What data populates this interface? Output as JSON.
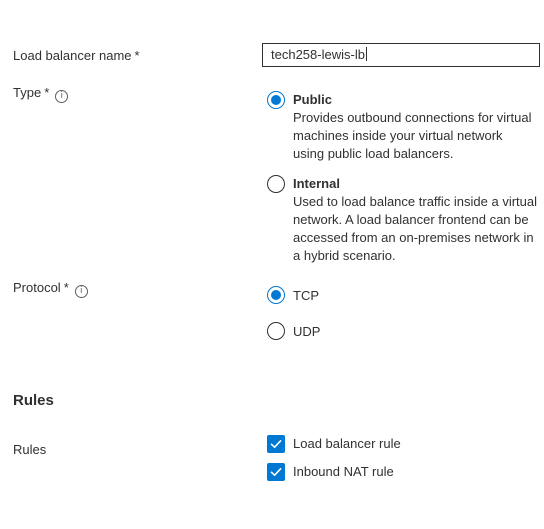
{
  "form": {
    "lb_name": {
      "label": "Load balancer name",
      "required_mark": "*",
      "value": "tech258-lewis-lb"
    },
    "type": {
      "label": "Type",
      "required_mark": "*",
      "info_glyph": "i",
      "selected": "Public",
      "options": [
        {
          "title": "Public",
          "description_lines": [
            "Provides outbound connections for virtual",
            "machines inside your virtual network",
            "using public load balancers."
          ],
          "checked": true
        },
        {
          "title": "Internal",
          "description_lines": [
            "Used to load balance traffic inside a virtual",
            "network. A load balancer frontend can be",
            "accessed from an on-premises network in",
            "a hybrid scenario."
          ],
          "checked": false
        }
      ]
    },
    "protocol": {
      "label": "Protocol",
      "required_mark": "*",
      "info_glyph": "i",
      "selected": "TCP",
      "options": [
        {
          "label": "TCP",
          "checked": true
        },
        {
          "label": "UDP",
          "checked": false
        }
      ]
    }
  },
  "rules_section": {
    "heading": "Rules",
    "label": "Rules",
    "checkboxes": [
      {
        "label": "Load balancer rule",
        "checked": true
      },
      {
        "label": "Inbound NAT rule",
        "checked": true
      }
    ]
  },
  "colors": {
    "accent": "#0078d4",
    "text": "#323130"
  },
  "icons": {
    "info": "info-icon",
    "check": "checkmark-icon"
  }
}
